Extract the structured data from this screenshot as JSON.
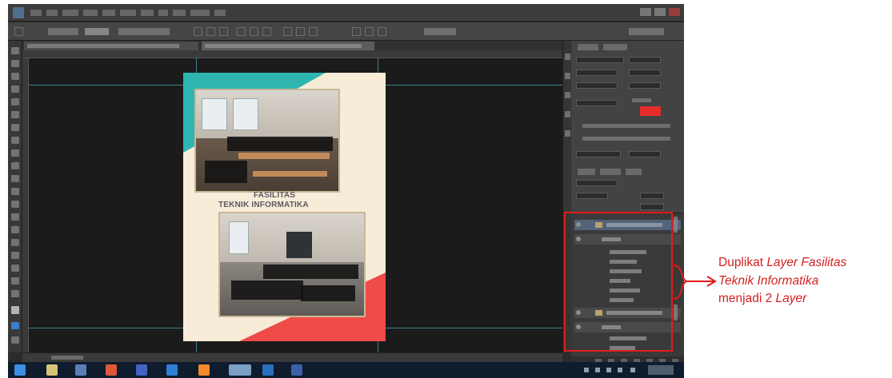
{
  "app": {
    "name": "Adobe Photoshop",
    "document_heading_line1": "FASILITAS",
    "document_heading_line2": "TEKNIK INFORMATIKA"
  },
  "annotation": {
    "line1_plain": "Duplikat ",
    "line1_italic": "Layer Fasilitas",
    "line2_italic": "Teknik Informatika",
    "line3_plain": "menjadi 2 ",
    "line3_italic": "Layer"
  },
  "colors": {
    "accent_red": "#e21b1b",
    "annotation_text": "#d42020",
    "teal_shape": "#2fb5b0",
    "coral_shape": "#ef4b48",
    "page_bg": "#f7ecd8"
  },
  "icons": {
    "app_logo": "photoshop-icon",
    "tools": "tool-icons",
    "visibility": "eye-icon",
    "group": "folder-icon",
    "taskbar_start": "windows-start-icon"
  }
}
